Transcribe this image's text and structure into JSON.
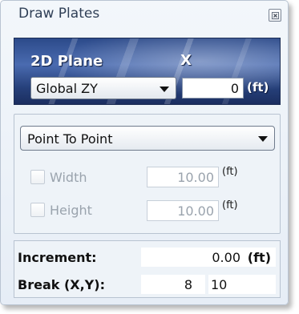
{
  "window": {
    "title": "Draw Plates",
    "close_icon": "close-icon"
  },
  "plane": {
    "label": "2D Plane",
    "x_label": "X",
    "selected": "Global ZY",
    "x_value": "0",
    "x_unit": "(ft)"
  },
  "mode": {
    "selected": "Point To Point",
    "width": {
      "label": "Width",
      "value": "10.00",
      "unit": "(ft)",
      "checked": false
    },
    "height": {
      "label": "Height",
      "value": "10.00",
      "unit": "(ft)",
      "checked": false
    }
  },
  "increment": {
    "label": "Increment:",
    "value": "0.00",
    "unit": "(ft)"
  },
  "break": {
    "label": "Break (X,Y):",
    "x": "8",
    "y": "10"
  }
}
